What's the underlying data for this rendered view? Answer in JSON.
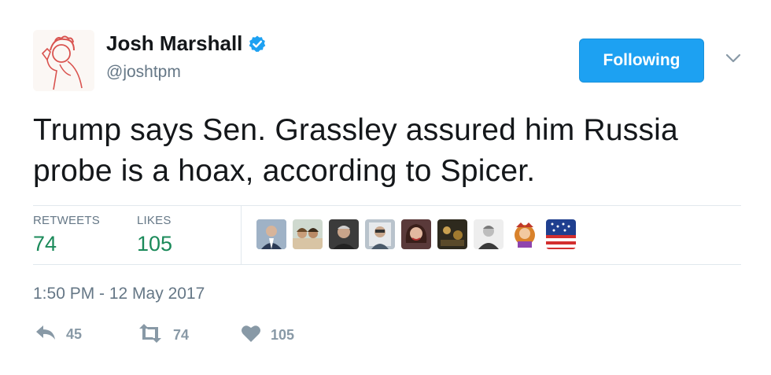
{
  "tweet": {
    "author": {
      "name": "Josh Marshall",
      "handle": "@joshtpm",
      "verified": true
    },
    "follow_button_label": "Following",
    "text": "Trump says Sen. Grassley assured him Russia probe is a hoax, according to Spicer.",
    "stats": {
      "retweets_label": "RETWEETS",
      "retweets_value": "74",
      "likes_label": "LIKES",
      "likes_value": "105"
    },
    "likers": [
      {
        "name": "liker-avatar-1"
      },
      {
        "name": "liker-avatar-2"
      },
      {
        "name": "liker-avatar-3"
      },
      {
        "name": "liker-avatar-4"
      },
      {
        "name": "liker-avatar-5"
      },
      {
        "name": "liker-avatar-6"
      },
      {
        "name": "liker-avatar-7"
      },
      {
        "name": "liker-avatar-8"
      },
      {
        "name": "liker-avatar-9"
      }
    ],
    "timestamp": "1:50 PM - 12 May 2017",
    "actions": {
      "reply_count": "45",
      "retweet_count": "74",
      "like_count": "105"
    }
  },
  "colors": {
    "accent": "#1da1f2",
    "stat_value": "#1b8a5a",
    "secondary_text": "#657786",
    "action_icon": "#8899a6"
  },
  "icons": {
    "verified": "verified-badge-icon",
    "chevron": "chevron-down-icon",
    "reply": "reply-icon",
    "retweet": "retweet-icon",
    "like": "heart-icon"
  }
}
